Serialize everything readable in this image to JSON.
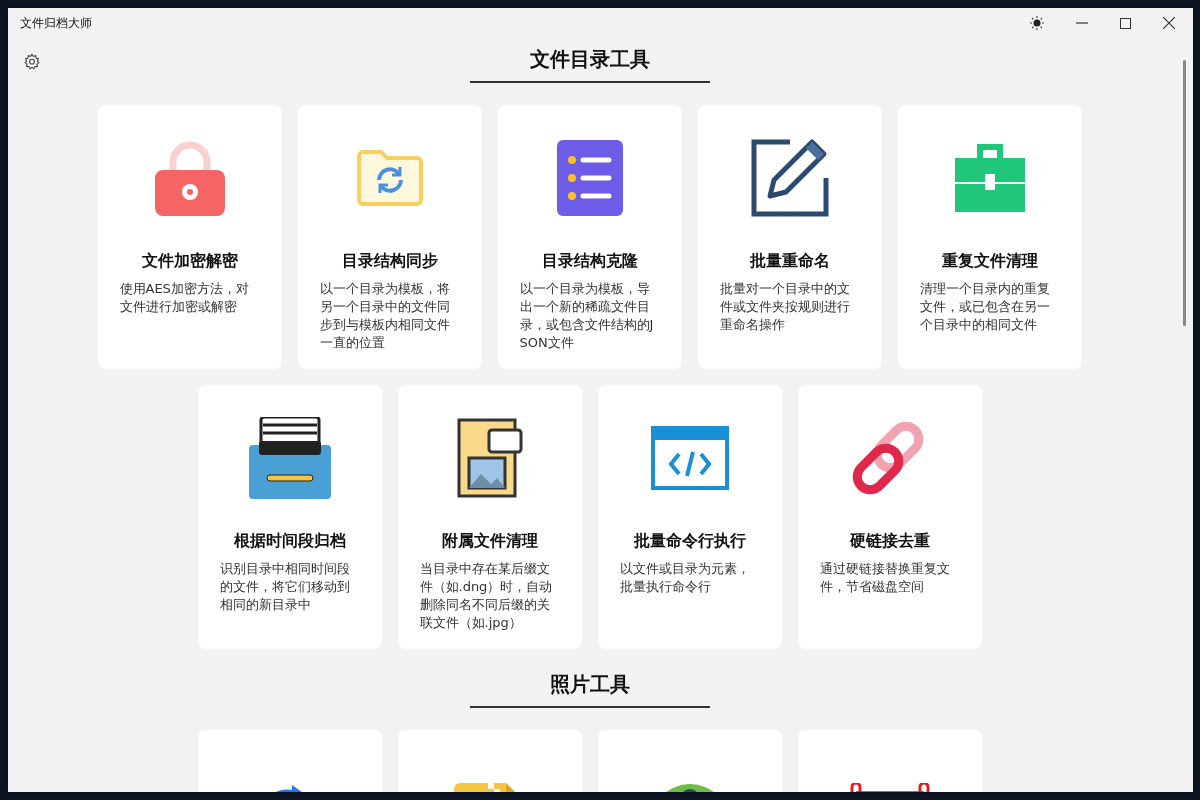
{
  "window": {
    "title": "文件归档大师"
  },
  "sections": [
    {
      "title": "文件目录工具",
      "tools": [
        {
          "title": "文件加密解密",
          "description": "使用AES加密方法，对文件进行加密或解密"
        },
        {
          "title": "目录结构同步",
          "description": "以一个目录为模板，将另一个目录中的文件同步到与模板内相同文件一直的位置"
        },
        {
          "title": "目录结构克隆",
          "description": "以一个目录为模板，导出一个新的稀疏文件目录，或包含文件结构的JSON文件"
        },
        {
          "title": "批量重命名",
          "description": "批量对一个目录中的文件或文件夹按规则进行重命名操作"
        },
        {
          "title": "重复文件清理",
          "description": "清理一个目录内的重复文件，或已包含在另一个目录中的相同文件"
        },
        {
          "title": "根据时间段归档",
          "description": "识别目录中相同时间段的文件，将它们移动到相同的新目录中"
        },
        {
          "title": "附属文件清理",
          "description": "当目录中存在某后缀文件（如.dng）时，自动删除同名不同后缀的关联文件（如.jpg）"
        },
        {
          "title": "批量命令行执行",
          "description": "以文件或目录为元素，批量执行命令行"
        },
        {
          "title": "硬链接去重",
          "description": "通过硬链接替换重复文件，节省磁盘空间"
        }
      ]
    },
    {
      "title": "照片工具"
    }
  ]
}
